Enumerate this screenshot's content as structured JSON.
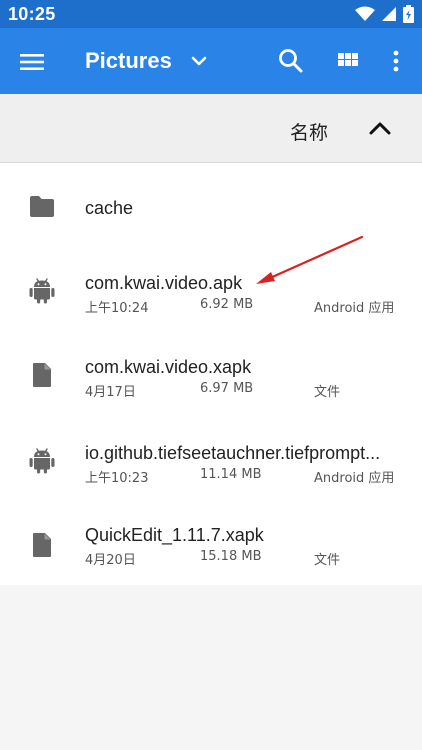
{
  "status_bar": {
    "time": "10:25",
    "icons": [
      "wifi-icon",
      "signal-icon",
      "battery-icon"
    ]
  },
  "app_bar": {
    "title": "Pictures",
    "icons": [
      "menu-icon",
      "chevron-down-icon",
      "search-icon",
      "grid-view-icon",
      "more-vert-icon"
    ],
    "color": "#2a83e6"
  },
  "sort_bar": {
    "label": "名称",
    "direction_icon": "chevron-up-icon"
  },
  "files": [
    {
      "name": "cache",
      "icon": "folder-icon",
      "date": "",
      "size": "",
      "type": ""
    },
    {
      "name": "com.kwai.video.apk",
      "icon": "android-icon",
      "date": "上午10:24",
      "size": "6.92 MB",
      "type": "Android 应用"
    },
    {
      "name": "com.kwai.video.xapk",
      "icon": "file-icon",
      "date": "4月17日",
      "size": "6.97 MB",
      "type": "文件"
    },
    {
      "name": "io.github.tiefseetauchner.tiefprompt...",
      "icon": "android-icon",
      "date": "上午10:23",
      "size": "11.14 MB",
      "type": "Android 应用"
    },
    {
      "name": "QuickEdit_1.11.7.xapk",
      "icon": "file-icon",
      "date": "4月20日",
      "size": "15.18 MB",
      "type": "文件"
    }
  ],
  "annotation": {
    "color": "#d62222",
    "target": "com.kwai.video.apk"
  }
}
